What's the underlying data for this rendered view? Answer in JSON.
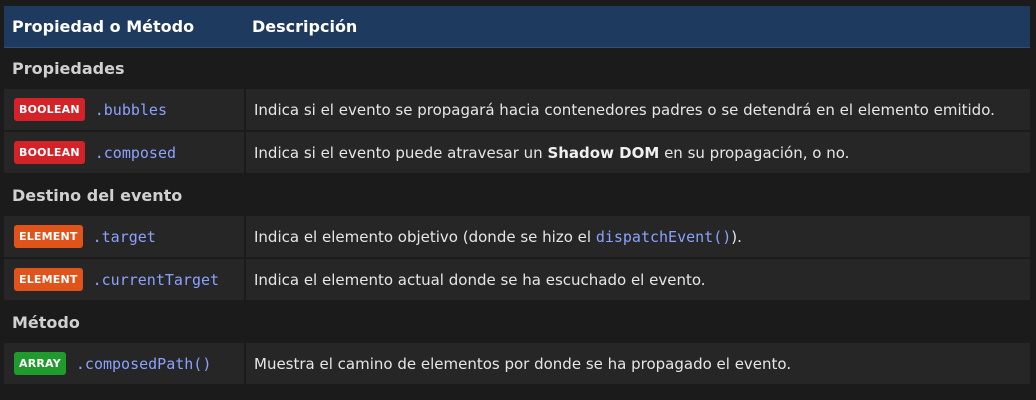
{
  "header": {
    "col1": "Propiedad o Método",
    "col2": "Descripción"
  },
  "groups": [
    {
      "title": "Propiedades",
      "rows": [
        {
          "badge": "BOOLEAN",
          "badge_color": "#d42328",
          "name": ".bubbles",
          "desc": "Indica si el evento se propagará hacia contenedores padres o se detendrá en el elemento emitido."
        },
        {
          "badge": "BOOLEAN",
          "badge_color": "#d42328",
          "name": ".composed",
          "desc_pre": "Indica si el evento puede atravesar un ",
          "desc_strong": "Shadow DOM",
          "desc_post": " en su propagación, o no."
        }
      ]
    },
    {
      "title": "Destino del evento",
      "rows": [
        {
          "badge": "ELEMENT",
          "badge_color": "#e0531a",
          "name": ".target",
          "desc_pre": "Indica el elemento objetivo (donde se hizo el ",
          "desc_code": "dispatchEvent()",
          "desc_post": ")."
        },
        {
          "badge": "ELEMENT",
          "badge_color": "#e0531a",
          "name": ".currentTarget",
          "desc": "Indica el elemento actual donde se ha escuchado el evento."
        }
      ]
    },
    {
      "title": "Método",
      "rows": [
        {
          "badge": "ARRAY",
          "badge_color": "#1f9a2c",
          "name": ".composedPath()",
          "desc": "Muestra el camino de elementos por donde se ha propagado el evento."
        }
      ]
    }
  ]
}
